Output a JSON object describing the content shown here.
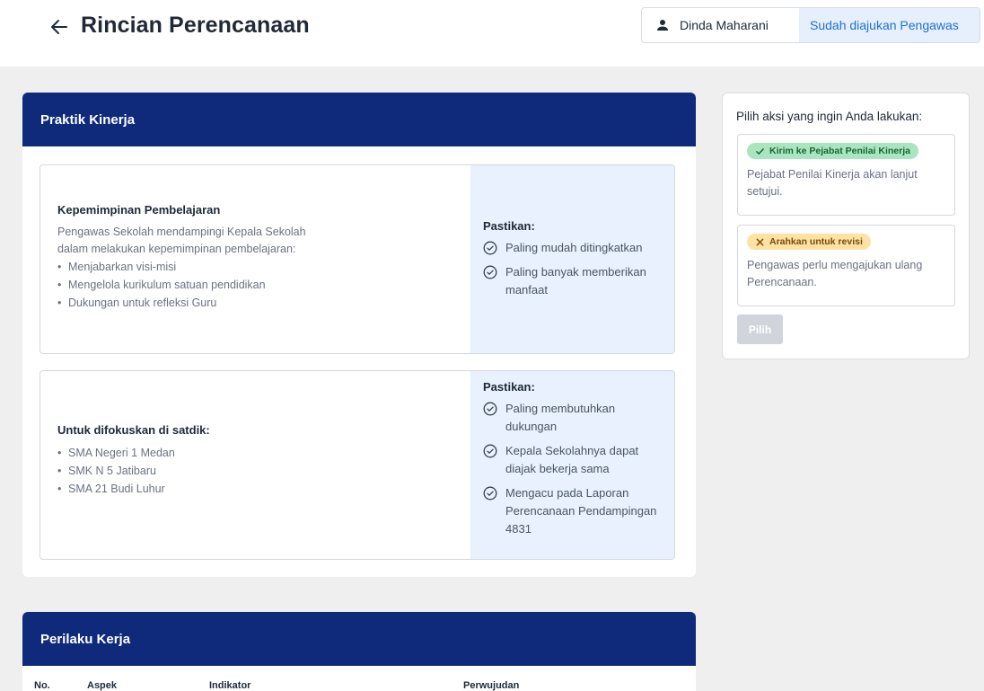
{
  "header": {
    "title": "Rincian Perencanaan",
    "user_name": "Dinda Maharani",
    "status": "Sudah diajukan Pengawas"
  },
  "praktik": {
    "title": "Praktik Kinerja",
    "section1": {
      "heading": "Kepemimpinan Pembelajaran",
      "desc_line1": "Pengawas Sekolah mendampingi Kepala Sekolah",
      "desc_line2": "dalam melakukan kepemimpinan pembelajaran:",
      "bullets": [
        "Menjabarkan visi-misi",
        "Mengelola kurikulum satuan pendidikan",
        "Dukungan untuk refleksi Guru"
      ],
      "checks_title": "Pastikan:",
      "checks": [
        "Paling mudah ditingkatkan",
        "Paling banyak memberikan manfaat"
      ]
    },
    "section2": {
      "heading": "Untuk difokuskan di satdik:",
      "bullets": [
        "SMA Negeri 1 Medan",
        "SMK N 5 Jatibaru",
        "SMA 21 Budi Luhur"
      ],
      "checks_title": "Pastikan:",
      "checks": [
        "Paling membutuhkan dukungan",
        "Kepala Sekolahnya dapat diajak bekerja sama",
        "Mengacu pada Laporan Perencanaan Pendampingan 4831"
      ]
    }
  },
  "actions": {
    "title": "Pilih aksi yang ingin Anda lakukan:",
    "options": [
      {
        "label": "Kirim ke Pejabat Penilai Kinerja",
        "desc": "Pejabat Penilai Kinerja akan lanjut setujui.",
        "color": "#a9e6c0"
      },
      {
        "label": "Arahkan untuk revisi",
        "desc": "Pengawas perlu mengajukan ulang Perencanaan.",
        "color": "#fde2a4"
      }
    ],
    "button": "Pilih"
  },
  "perilaku": {
    "title": "Perilaku Kerja",
    "columns": [
      "No.",
      "Aspek",
      "Indikator",
      "Perwujudan"
    ]
  },
  "colors": {
    "header_blue": "#0f2a7a",
    "status_blue": "#1d6fd6",
    "panel_tint": "#e8f1fd"
  }
}
